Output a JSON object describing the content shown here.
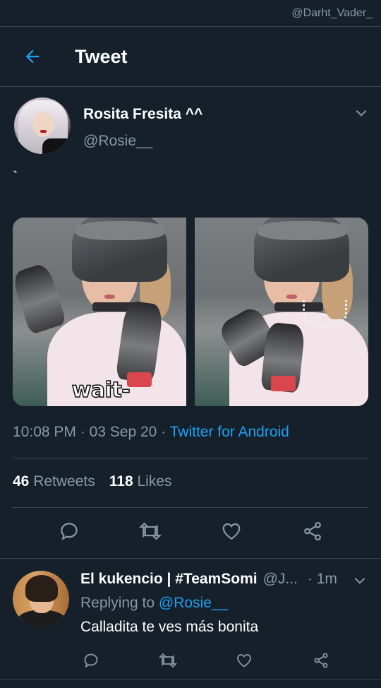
{
  "watermark": "@Darht_Vader_",
  "header": {
    "title": "Tweet"
  },
  "tweet": {
    "author_name": "Rosita Fresita ^^",
    "author_handle": "@Rosie__",
    "text": "`",
    "image_caption": "wait-",
    "time": "10:08 PM",
    "date": "03 Sep 20",
    "source": "Twitter for Android",
    "retweets_count": "46",
    "retweets_label": "Retweets",
    "likes_count": "118",
    "likes_label": "Likes"
  },
  "reply": {
    "name": "El kukencio | #TeamSomi",
    "handle": "@J...",
    "time": "· 1m",
    "replying_prefix": "Replying to",
    "replying_mention": "@Rosie__",
    "text": "Calladita te ves más bonita"
  },
  "colors": {
    "background": "#15202b",
    "accent": "#1da1f2",
    "muted": "#8899a6",
    "divider": "#38444d"
  },
  "icons": {
    "back": "arrow-left-icon",
    "more": "chevron-down-icon",
    "reply": "comment-icon",
    "retweet": "retweet-icon",
    "like": "heart-icon",
    "share": "share-icon"
  }
}
